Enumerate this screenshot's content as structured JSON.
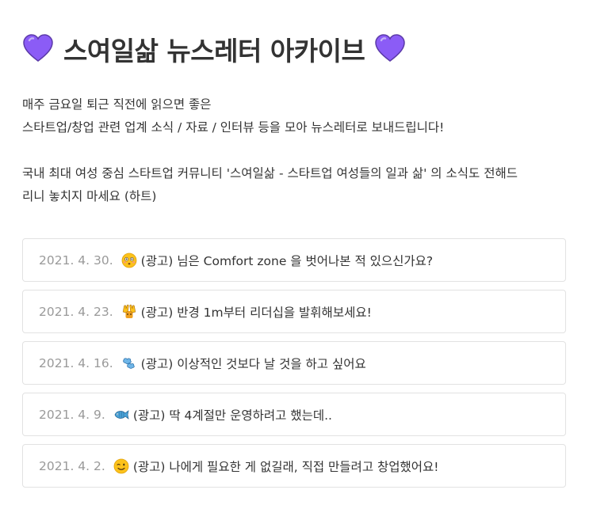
{
  "header": {
    "title": "스여일삶 뉴스레터 아카이브",
    "heart_icon": "purple-heart",
    "heart_color": "#8b5cf6"
  },
  "intro": {
    "line1": "매주 금요일 퇴근 직전에 읽으면 좋은",
    "line2": "스타트업/창업 관련 업계 소식 / 자료 / 인터뷰 등을 모아 뉴스레터로 보내드립니다!",
    "line3": "국내 최대 여성 중심 스타트업 커뮤니티 '스여일삶 - 스타트업 여성들의 일과 삶' 의 소식도 전해드",
    "line4": "리니 놓치지 마세요 (하트)"
  },
  "posts": [
    {
      "date": "2021. 4. 30.",
      "emoji": "flushed-face",
      "title": "(광고) 님은 Comfort zone 을 벗어나본 적 있으신가요?"
    },
    {
      "date": "2021. 4. 23.",
      "emoji": "raising-hands",
      "title": "(광고) 반경 1m부터 리더십을 발휘해보세요!"
    },
    {
      "date": "2021. 4. 16.",
      "emoji": "dashing-away",
      "title": "(광고) 이상적인 것보다 날 것을 하고 싶어요"
    },
    {
      "date": "2021. 4. 9.",
      "emoji": "fish",
      "title": "(광고) 딱 4계절만 운영하려고 했는데.."
    },
    {
      "date": "2021. 4. 2.",
      "emoji": "winking-face",
      "title": "(광고) 나에게 필요한 게 없길래, 직접 만들려고 창업했어요!"
    }
  ]
}
